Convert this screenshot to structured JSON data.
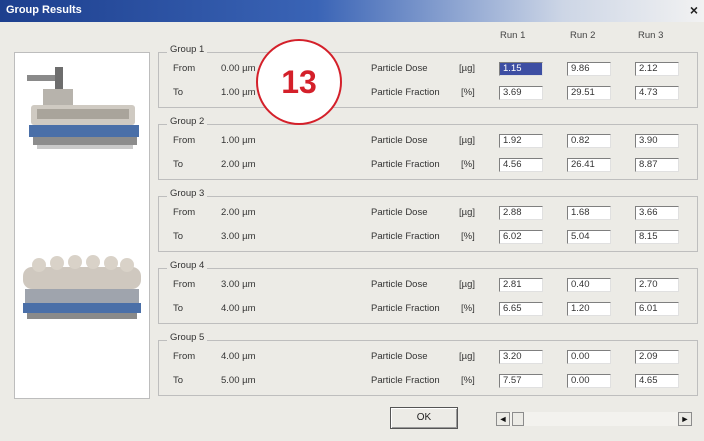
{
  "window": {
    "title": "Group Results",
    "close_label": "×"
  },
  "columns": {
    "run1": "Run 1",
    "run2": "Run 2",
    "run3": "Run 3"
  },
  "row_labels": {
    "from": "From",
    "to": "To"
  },
  "metrics": {
    "dose_label": "Particle Dose",
    "dose_unit": "[µg]",
    "fraction_label": "Particle Fraction",
    "fraction_unit": "[%]"
  },
  "groups": [
    {
      "title": "Group 1",
      "from": "0.00 µm",
      "to": "1.00 µm",
      "dose": [
        "1.15",
        "9.86",
        "2.12"
      ],
      "fraction": [
        "3.69",
        "29.51",
        "4.73"
      ]
    },
    {
      "title": "Group 2",
      "from": "1.00 µm",
      "to": "2.00 µm",
      "dose": [
        "1.92",
        "0.82",
        "3.90"
      ],
      "fraction": [
        "4.56",
        "26.41",
        "8.87"
      ]
    },
    {
      "title": "Group 3",
      "from": "2.00 µm",
      "to": "3.00 µm",
      "dose": [
        "2.88",
        "1.68",
        "3.66"
      ],
      "fraction": [
        "6.02",
        "5.04",
        "8.15"
      ]
    },
    {
      "title": "Group 4",
      "from": "3.00 µm",
      "to": "4.00 µm",
      "dose": [
        "2.81",
        "0.40",
        "2.70"
      ],
      "fraction": [
        "6.65",
        "1.20",
        "6.01"
      ]
    },
    {
      "title": "Group 5",
      "from": "4.00 µm",
      "to": "5.00 µm",
      "dose": [
        "3.20",
        "0.00",
        "2.09"
      ],
      "fraction": [
        "7.57",
        "0.00",
        "4.65"
      ]
    }
  ],
  "badge": "13",
  "ok_button": "OK",
  "scrollbar": {
    "left_arrow": "◄",
    "right_arrow": "►"
  },
  "colors": {
    "badge": "#d4202a",
    "titlebar": "#1d3f8e",
    "selection": "#3d4ea3"
  }
}
